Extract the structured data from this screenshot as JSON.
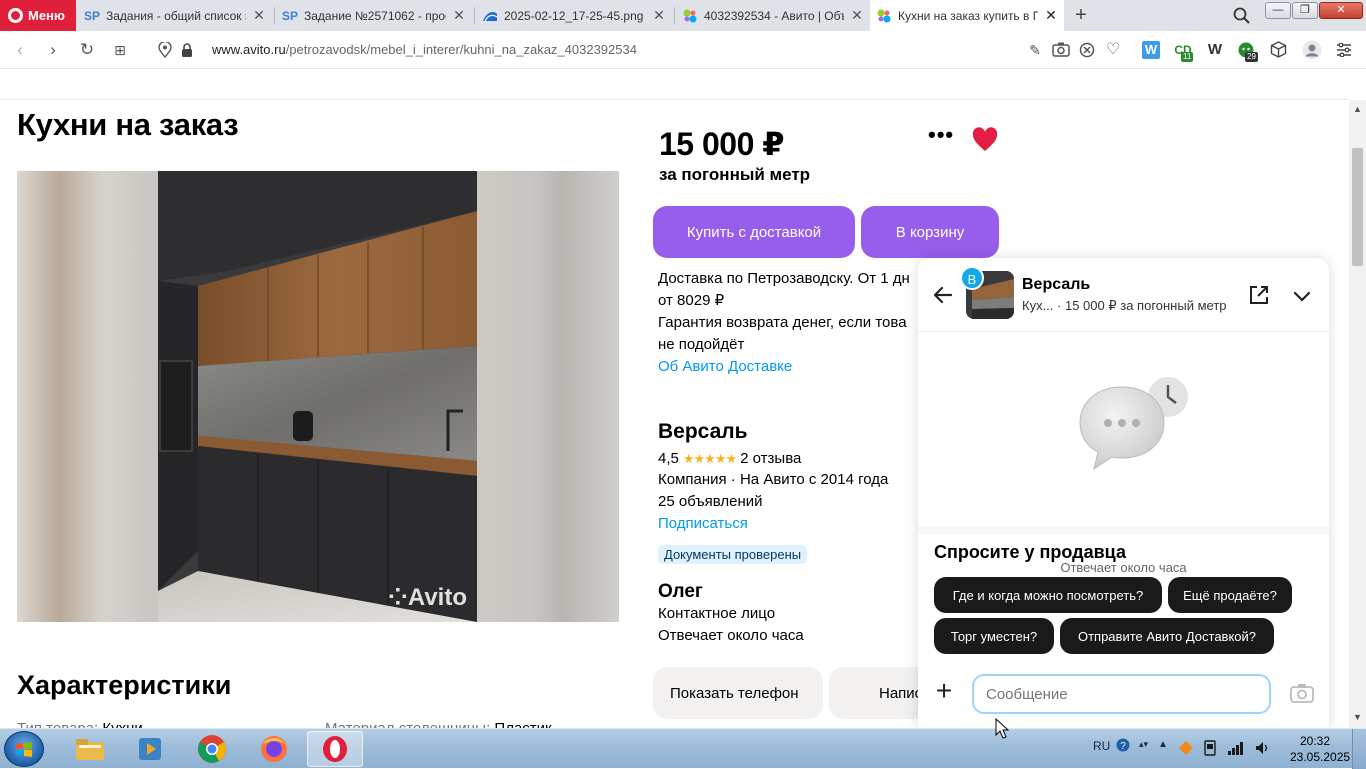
{
  "browser": {
    "menu_label": "Меню",
    "tabs": [
      {
        "title": "Задания - общий список з",
        "icon": "sp-icon"
      },
      {
        "title": "Задание №2571062 - прос",
        "icon": "sp-icon"
      },
      {
        "title": "2025-02-12_17-25-45.png -",
        "icon": "image-icon"
      },
      {
        "title": "4032392534 - Авито | Объ",
        "icon": "avito-icon"
      },
      {
        "title": "Кухни на заказ купить в П",
        "icon": "avito-icon",
        "active": true
      }
    ],
    "url_domain": "www.avito.ru",
    "url_path": "/petrozavodsk/mebel_i_interer/kuhni_na_zakaz_4032392534",
    "ext_badges": {
      "cd": "11",
      "cat": "29"
    }
  },
  "listing": {
    "title": "Кухни на заказ",
    "watermark": "Avito",
    "price": "15 000 ₽",
    "price_unit": "за погонный метр",
    "buy_delivery": "Купить с доставкой",
    "to_cart": "В корзину",
    "delivery_line1": "Доставка по Петрозаводску. От 1 дн",
    "delivery_line2": "от 8029 ₽",
    "guarantee": "Гарантия возврата денег, если това",
    "guarantee2": "не подойдёт",
    "delivery_link": "Об Авито Доставке",
    "characteristics_title": "Характеристики",
    "char_type_label": "Тип товара:",
    "char_type_value": "Кухни",
    "char_top_label": "Материал столешницы:",
    "char_top_value": "Пластик"
  },
  "seller": {
    "name": "Версаль",
    "rating": "4,5",
    "stars": "★★★★★",
    "reviews": "2 отзыва",
    "company": "Компания · На Авито с 2014 года",
    "ads": "25 объявлений",
    "subscribe": "Подписаться",
    "docs": "Документы проверены",
    "contact_name": "Олег",
    "contact_role": "Контактное лицо",
    "response": "Отвечает около часа",
    "show_phone": "Показать телефон",
    "write": "Напис"
  },
  "chat": {
    "avatar_letter": "В",
    "title": "Версаль",
    "subtitle_item": "Кух...",
    "subtitle_price": "· 15 000 ₽ за погонный метр",
    "response_hint": "Отвечает около часа",
    "ask_title": "Спросите у продавца",
    "chips": [
      "Где и когда можно посмотреть?",
      "Ещё продаёте?",
      "Торг уместен?",
      "Отправите Авито Доставкой?"
    ],
    "input_placeholder": "Сообщение"
  },
  "taskbar": {
    "lang": "RU",
    "time": "20:32",
    "date": "23.05.2025"
  },
  "colors": {
    "accent_purple": "#965eeb",
    "link_blue": "#0099f7",
    "heart_red": "#e41d45",
    "opera_red": "#e0203b"
  }
}
